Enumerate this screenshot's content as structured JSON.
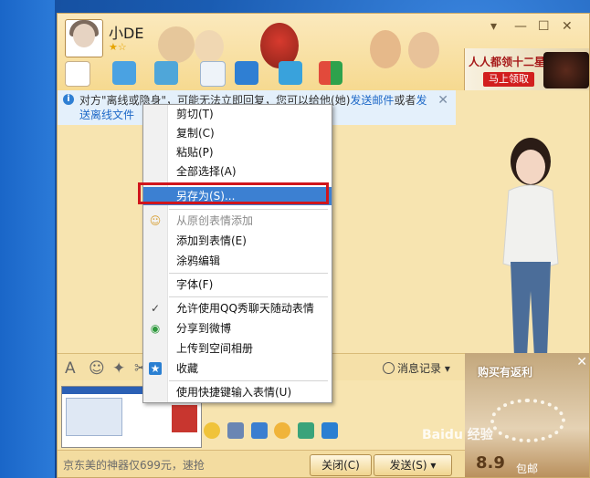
{
  "contact": {
    "name": "小DE"
  },
  "notice": {
    "part1": "对方\"离线或隐身\"，可能无法立即回复，您可以给他(她)",
    "link1": "发送邮件",
    "part2": "或者",
    "link2": "发送离线文件"
  },
  "ad_top": {
    "line1": "人人都领十二星",
    "button": "马上领取"
  },
  "toolbar": {
    "history_label": "消息记录"
  },
  "context_menu": {
    "items": [
      {
        "label": "剪切(T)"
      },
      {
        "label": "复制(C)"
      },
      {
        "label": "粘贴(P)"
      },
      {
        "label": "全部选择(A)"
      },
      {
        "label": "另存为(S)..."
      },
      {
        "label": "从原创表情添加"
      },
      {
        "label": "添加到表情(E)"
      },
      {
        "label": "涂鸦编辑"
      },
      {
        "label": "字体(F)"
      },
      {
        "label": "允许使用QQ秀聊天随动表情"
      },
      {
        "label": "分享到微博"
      },
      {
        "label": "上传到空间相册"
      },
      {
        "label": "收藏"
      },
      {
        "label": "使用快捷键输入表情(U)"
      }
    ]
  },
  "bottom": {
    "ad_text": "京东美的神器仅699元，速抢",
    "close_label": "关闭(C)",
    "send_label": "发送(S)"
  },
  "ad_bottom": {
    "title": "购买有返利",
    "price": "8.9",
    "shipping": "包邮"
  },
  "watermark": "Baidu 经验",
  "colors": {
    "highlight": "#3c80d2",
    "red_box": "#d0151c",
    "link": "#1d68c7"
  }
}
